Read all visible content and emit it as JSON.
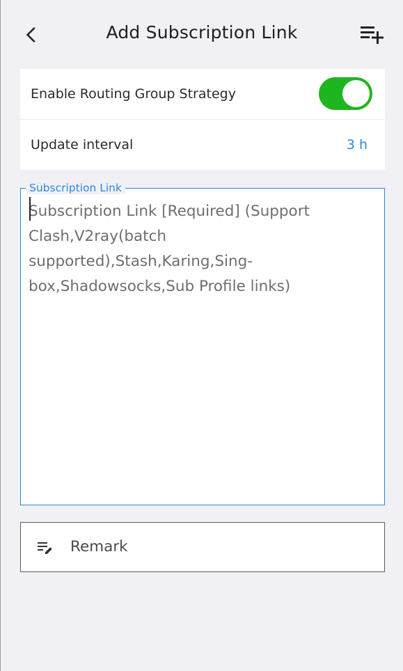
{
  "header": {
    "title": "Add Subscription Link",
    "back_icon": "back-arrow-icon",
    "add_icon": "playlist-add-icon"
  },
  "settings": {
    "routing_group": {
      "label": "Enable Routing Group Strategy",
      "enabled": true
    },
    "update_interval": {
      "label": "Update interval",
      "value": "3 h"
    }
  },
  "subscription": {
    "label": "Subscription Link",
    "placeholder": "Subscription Link [Required] (Support Clash,V2ray(batch supported),Stash,Karing,Sing-box,Shadowsocks,Sub Profile links)",
    "value": ""
  },
  "remark": {
    "placeholder": "Remark",
    "icon": "edit-note-icon",
    "value": ""
  },
  "colors": {
    "accent": "#2b88d8",
    "toggle_on": "#1fb51f",
    "background": "#f1f0f5"
  }
}
